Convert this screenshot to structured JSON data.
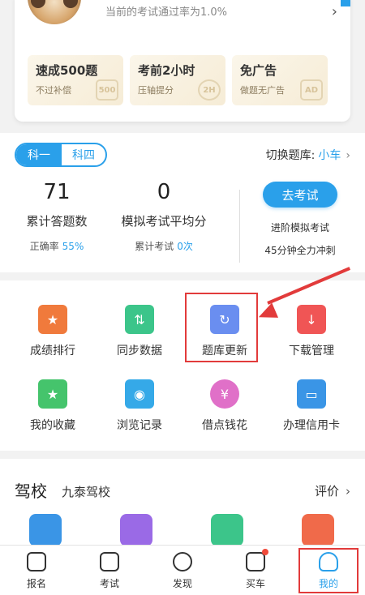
{
  "profile": {
    "pass_rate_text": "当前的考试通过率为1.0%"
  },
  "features": [
    {
      "title": "速成500题",
      "subtitle": "不过补偿",
      "icon_text": "500"
    },
    {
      "title": "考前2小时",
      "subtitle": "压轴提分",
      "icon_text": "2H"
    },
    {
      "title": "免广告",
      "subtitle": "做题无广告",
      "icon_text": "AD"
    }
  ],
  "subjects": {
    "active": "科一",
    "inactive": "科四"
  },
  "bank_switch": {
    "label": "切换题库:",
    "value": "小车"
  },
  "stats": [
    {
      "value": "71",
      "label": "累计答题数",
      "sub_label": "正确率",
      "sub_value": "55%"
    },
    {
      "value": "0",
      "label": "模拟考试平均分",
      "sub_label": "累计考试",
      "sub_value": "0次"
    }
  ],
  "exam": {
    "button": "去考试",
    "note1": "进阶模拟考试",
    "note2": "45分钟全力冲刺"
  },
  "grid": [
    {
      "label": "成绩排行",
      "icon": "trophy-icon",
      "color": "#f07a3c"
    },
    {
      "label": "同步数据",
      "icon": "sync-icon",
      "color": "#3cc58a"
    },
    {
      "label": "题库更新",
      "icon": "refresh-icon",
      "color": "#6a8ef0"
    },
    {
      "label": "下载管理",
      "icon": "download-icon",
      "color": "#f05555"
    },
    {
      "label": "我的收藏",
      "icon": "star-folder-icon",
      "color": "#45c46c"
    },
    {
      "label": "浏览记录",
      "icon": "history-icon",
      "color": "#35a9e8"
    },
    {
      "label": "借点钱花",
      "icon": "money-bag-icon",
      "color": "#e070c8"
    },
    {
      "label": "办理信用卡",
      "icon": "credit-card-icon",
      "color": "#3a95e6"
    }
  ],
  "driving_school": {
    "title": "驾校",
    "name": "九泰驾校",
    "review": "评价"
  },
  "tabs": [
    {
      "label": "报名"
    },
    {
      "label": "考试"
    },
    {
      "label": "发现"
    },
    {
      "label": "买车"
    },
    {
      "label": "我的"
    }
  ],
  "colors": {
    "accent": "#2aa0ea",
    "annotation": "#e23b3b"
  }
}
